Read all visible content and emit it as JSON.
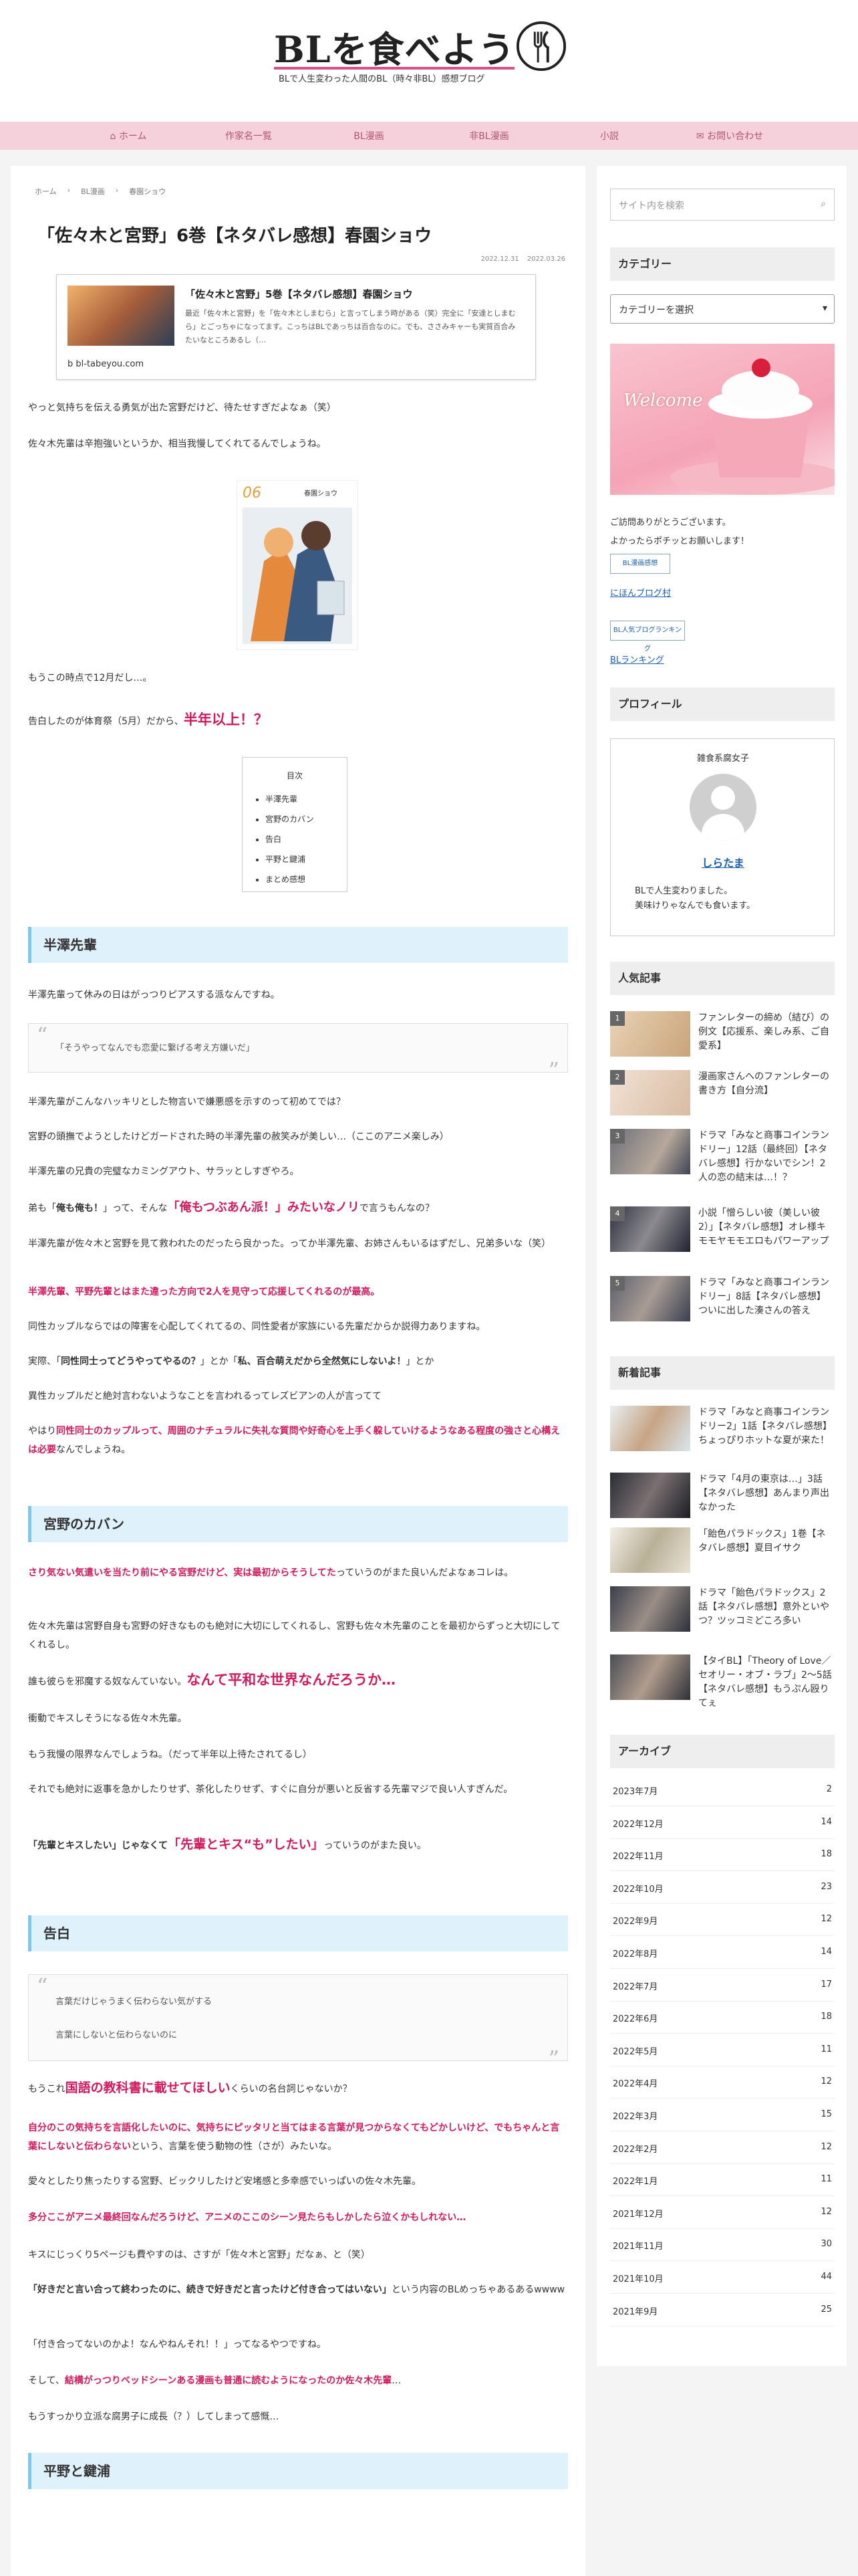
{
  "site": {
    "title": "BLを食べよう",
    "tagline": "BLで人生変わった人間のBL（時々非BL）感想ブログ"
  },
  "nav": [
    "ホーム",
    "作家名一覧",
    "BL漫画",
    "非BL漫画",
    "小説",
    "お問い合わせ"
  ],
  "breadcrumb": [
    "ホーム",
    "BL漫画",
    "春園ショウ"
  ],
  "post": {
    "title": "「佐々木と宮野」6巻【ネタバレ感想】春園ショウ",
    "published": "2022.12.31",
    "updated": "2022.03.26",
    "card": {
      "title": "「佐々木と宮野」5巻【ネタバレ感想】春園ショウ",
      "text": "最近「佐々木と宮野」を「佐々木としまむら」と言ってしまう時がある（笑）完全に「安達としまむら」とごっちゃになってます。こっちはBLであっちは百合なのに。でも、ささみキャーも実質百合みたいなところあるし（…",
      "source": "bl-tabeyou.com"
    },
    "p1": "やっと気持ちを伝える勇気が出た宮野だけど、待たせすぎだよなぁ（笑）",
    "p2": "佐々木先輩は辛抱強いというか、相当我慢してくれてるんでしょうね。",
    "cover_label": "06",
    "cover_author": "春園ショウ",
    "p3": "もうこの時点で12月だし…。",
    "p4a": "告白したのが体育祭（5月）だから、",
    "p4b": "半年以上！？",
    "toc": {
      "title": "目次",
      "items": [
        "半澤先輩",
        "宮野のカバン",
        "告白",
        "平野と鍵浦",
        "まとめ感想"
      ]
    },
    "h_hanzawa": "半澤先輩",
    "s1p1": "半澤先輩って休みの日はがっつりピアスする派なんですね。",
    "s1q": "「そうやってなんでも恋愛に繋げる考え方嫌いだ」",
    "s1p2": "半澤先輩がこんなハッキリとした物言いで嫌悪感を示すのって初めてでは？",
    "s1p3": "宮野の頭撫でようとしたけどガードされた時の半澤先輩の赦笑みが美しい…（ここのアニメ楽しみ）",
    "s1p4": "半澤先輩の兄貴の完璧なカミングアウト、サラッとしすぎやろ。",
    "s1p5a": "弟も「",
    "s1p5b": "俺も俺も！",
    "s1p5c": "」って、そんな",
    "s1p5d": "「俺もつぶあん派！」みたいなノリ",
    "s1p5e": "で言うもんなの？",
    "s1p6": "半澤先輩が佐々木と宮野を見て救われたのだったら良かった。ってか半澤先輩、お姉さんもいるはずだし、兄弟多いな（笑）",
    "s1p7": "半澤先輩、平野先輩とはまた違った方向で2人を見守って応援してくれるのが最高。",
    "s1p8": "同性カップルならではの障害を心配してくれてるの、同性愛者が家族にいる先輩だからか説得力ありますね。",
    "s1p9a": "実際、「",
    "s1p9b": "同性同士ってどうやってやるの？",
    "s1p9c": "」とか「",
    "s1p9d": "私、百合萌えだから全然気にしないよ！",
    "s1p9e": "」とか",
    "s1p10": "異性カップルだと絶対言わないようなことを言われるってレズビアンの人が言ってて",
    "s1p11a": "やはり",
    "s1p11b": "同性同士のカップルって、周囲のナチュラルに失礼な質問や好奇心を上手く躱していけるようなある程度の強さと心構えは必要",
    "s1p11c": "なんでしょうね。",
    "h_bag": "宮野のカバン",
    "s2p1a": "さり気ない気遣いを当たり前にやる宮野だけど、実は最初からそうしてた",
    "s2p1b": "っていうのがまた良いんだよなぁコレは。",
    "s2p2": "佐々木先輩は宮野自身も宮野の好きなものも絶対に大切にしてくれるし、宮野も佐々木先輩のことを最初からずっと大切にしてくれるし。",
    "s2p3a": "誰も彼らを邪魔する奴なんていない。",
    "s2p3b": "なんて平和な世界なんだろうか…",
    "s2p4": "衝動でキスしそうになる佐々木先輩。",
    "s2p5": "もう我慢の限界なんでしょうね。（だって半年以上待たされてるし）",
    "s2p6": "それでも絶対に返事を急かしたりせず、茶化したりせず、すぐに自分が悪いと反省する先輩マジで良い人すぎんだ。",
    "s2p7a": "「先輩とキスしたい」じゃなくて",
    "s2p7b": "「先輩とキス“も”したい」",
    "s2p7c": "っていうのがまた良い。",
    "h_confess": "告白",
    "s3q1": "言葉だけじゃうまく伝わらない気がする",
    "s3q2": "言葉にしないと伝わらないのに",
    "s3p1a": "もうこれ",
    "s3p1b": "国語の教科書に載せてほしい",
    "s3p1c": "くらいの名台詞じゃないか？",
    "s3p2": "自分のこの気持ちを言語化したいのに、気持ちにピッタリと当てはまる言葉が見つからなくてもどかしいけど、でもちゃんと言葉にしないと伝わらない",
    "s3p2b": "という、言葉を使う動物の性（さが）みたいな。",
    "s3p3": "愛々としたり焦ったりする宮野、ビックリしたけど安堵感と多幸感でいっぱいの佐々木先輩。",
    "s3p4": "多分ここがアニメ最終回なんだろうけど、アニメのここのシーン見たらもしかしたら泣くかもしれない…",
    "s3p5": "キスにじっくり5ページも費やすのは、さすが「佐々木と宮野」だなぁ、と（笑）",
    "s3p6a": "「好きだと言い合って終わったのに、続きで好きだと言ったけど付き合ってはいない」",
    "s3p6b": "という内容のBLめっちゃあるあるwwww",
    "s3p7": "「付き合ってないのかよ！なんやねんそれ！！」ってなるやつですね。",
    "s3p8a": "そして、",
    "s3p8b": "結構がっつりベッドシーンある漫画も普通に読むようになったのか佐々木先輩",
    "s3p8c": "…",
    "s3p9": "もうすっかり立派な腐男子に成長（？）してしまって感慨…",
    "h_hirano": "平野と鍵浦"
  },
  "sidebar": {
    "search_placeholder": "サイト内を検索",
    "category_heading": "カテゴリー",
    "category_select": "カテゴリーを選択",
    "welcome": "Welcome",
    "visit_text1": "ご訪問ありがとうございます。",
    "visit_text2": "よかったらポチッとお願いします！",
    "badge1": "BL漫画感想",
    "link1": "にほんブログ村",
    "badge2": "BL人気ブログランキング",
    "link2": "BLランキング",
    "profile_heading": "プロフィール",
    "profile_role": "雑食系腐女子",
    "profile_name": "しらたま",
    "profile_bio1": "BLで人生変わりました。",
    "profile_bio2": "美味けりゃなんでも食います。",
    "popular_heading": "人気記事",
    "popular": [
      {
        "num": "1",
        "title": "ファンレターの締め（結び）の例文【応援系、楽しみ系、ご自愛系】"
      },
      {
        "num": "2",
        "title": "漫画家さんへのファンレターの書き方【自分流】"
      },
      {
        "num": "3",
        "title": "ドラマ「みなと商事コインランドリー」12話（最終回）【ネタバレ感想】行かないでシン！2人の恋の結末は…！？"
      },
      {
        "num": "4",
        "title": "小説「憎らしい彼（美しい彼2）」【ネタバレ感想】オレ様キモモヤモモエロもパワーアップ"
      },
      {
        "num": "5",
        "title": "ドラマ「みなと商事コインランドリー」8話【ネタバレ感想】ついに出した湊さんの答え"
      }
    ],
    "recent_heading": "新着記事",
    "recent": [
      "ドラマ「みなと商事コインランドリー2」1話【ネタバレ感想】ちょっぴりホットな夏が来た！",
      "ドラマ「4月の東京は…」3話【ネタバレ感想】あんまり声出なかった",
      "「飴色パラドックス」1巻【ネタバレ感想】夏目イサク",
      "ドラマ「飴色パラドックス」2話【ネタバレ感想】意外といやつ？ツッコミどころ多い",
      "【タイBL】「Theory of Love／セオリー・オブ・ラブ」2〜5話【ネタバレ感想】もうぷん殴りてぇ"
    ],
    "archive_heading": "アーカイブ",
    "archive": [
      {
        "month": "2023年7月",
        "count": "2"
      },
      {
        "month": "2022年12月",
        "count": "14"
      },
      {
        "month": "2022年11月",
        "count": "18"
      },
      {
        "month": "2022年10月",
        "count": "23"
      },
      {
        "month": "2022年9月",
        "count": "12"
      },
      {
        "month": "2022年8月",
        "count": "14"
      },
      {
        "month": "2022年7月",
        "count": "17"
      },
      {
        "month": "2022年6月",
        "count": "18"
      },
      {
        "month": "2022年5月",
        "count": "11"
      },
      {
        "month": "2022年4月",
        "count": "12"
      },
      {
        "month": "2022年3月",
        "count": "15"
      },
      {
        "month": "2022年2月",
        "count": "12"
      },
      {
        "month": "2022年1月",
        "count": "11"
      },
      {
        "month": "2021年12月",
        "count": "12"
      },
      {
        "month": "2021年11月",
        "count": "30"
      },
      {
        "month": "2021年10月",
        "count": "44"
      },
      {
        "month": "2021年9月",
        "count": "25"
      }
    ]
  },
  "colors": {
    "accent": "#d21a5f",
    "nav_bg": "#f5d1dc",
    "heading_bg": "#dff1fb"
  }
}
